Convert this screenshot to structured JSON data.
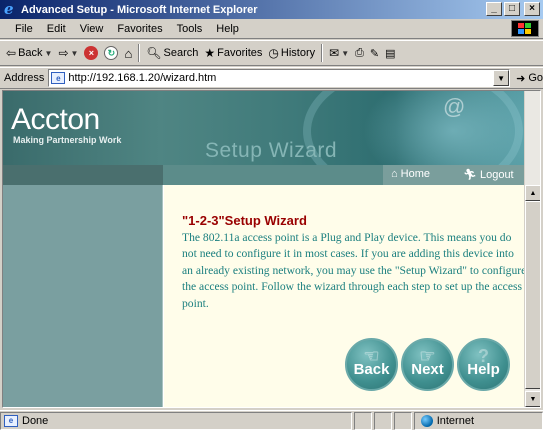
{
  "window": {
    "title": "Advanced Setup - Microsoft Internet Explorer",
    "buttons": {
      "minimize": "_",
      "maximize": "□",
      "close": "×"
    }
  },
  "menu": [
    "File",
    "Edit",
    "View",
    "Favorites",
    "Tools",
    "Help"
  ],
  "toolbar": {
    "back": "Back",
    "search": "Search",
    "favorites": "Favorites",
    "history": "History"
  },
  "address": {
    "label": "Address",
    "url": "http://192.168.1.20/wizard.htm",
    "go": "Go"
  },
  "banner": {
    "brand": "Accton",
    "tagline": "Making Partnership Work",
    "title": "Setup Wizard"
  },
  "nav": {
    "home": "Home",
    "logout": "Logout"
  },
  "wizard": {
    "title": "\"1-2-3\"Setup Wizard",
    "text": "The 802.11a access point is a Plug and Play device. This means you do not need to configure it in most cases. If you are adding this device into an already existing network, you may use the \"Setup Wizard\" to configure the access point. Follow the wizard through each step to set up the access point.",
    "buttons": {
      "back": "Back",
      "next": "Next",
      "help": "Help"
    }
  },
  "status": {
    "text": "Done",
    "zone": "Internet"
  },
  "colors": {
    "titlebar": "#0a246a",
    "banner": "#3f7a7a",
    "sidebar": "#7a9fa0",
    "content_bg": "#fffdea",
    "wizard_title": "#990000",
    "wizard_text": "#1b7f7f"
  }
}
